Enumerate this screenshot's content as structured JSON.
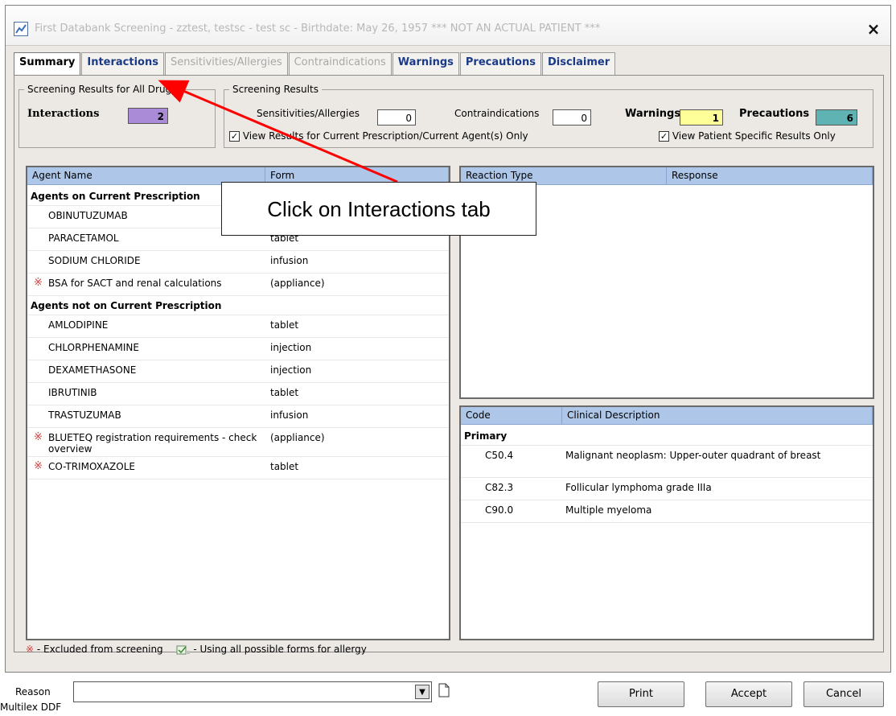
{
  "window": {
    "title": "First Databank Screening  - zztest, testsc  - test sc - Birthdate: May 26, 1957 *** NOT AN ACTUAL PATIENT ***",
    "close_label": "×"
  },
  "tabs": [
    {
      "label": "Summary",
      "state": "active"
    },
    {
      "label": "Interactions",
      "state": "enabled"
    },
    {
      "label": "Sensitivities/Allergies",
      "state": "disabled"
    },
    {
      "label": "Contraindications",
      "state": "disabled"
    },
    {
      "label": "Warnings",
      "state": "enabled"
    },
    {
      "label": "Precautions",
      "state": "enabled"
    },
    {
      "label": "Disclaimer",
      "state": "enabled"
    }
  ],
  "all_drugs": {
    "legend": "Screening Results for All Drugs",
    "interactions_label": "Interactions",
    "interactions_count": "2",
    "interactions_color": "#a98bd8"
  },
  "screening": {
    "legend": "Screening Results",
    "sensitivities_label": "Sensitivities/Allergies",
    "sensitivities_count": "0",
    "contraindications_label": "Contraindications",
    "contraindications_count": "0",
    "warnings_label": "Warnings",
    "warnings_count": "1",
    "warnings_color": "#ffff99",
    "precautions_label": "Precautions",
    "precautions_count": "6",
    "precautions_color": "#5fb3b3",
    "current_only_label": "View Results for Current Prescription/Current Agent(s) Only",
    "current_only_checked": "✓",
    "patient_only_label": "View Patient Specific Results Only",
    "patient_only_checked": "✓"
  },
  "agents": {
    "col_name": "Agent Name",
    "col_form": "Form",
    "group_current": "Agents on Current Prescription",
    "group_not_current": "Agents not on Current Prescription",
    "current": [
      {
        "name": "OBINUTUZUMAB",
        "form": "",
        "excluded": false
      },
      {
        "name": "PARACETAMOL",
        "form": "tablet",
        "excluded": false
      },
      {
        "name": "SODIUM CHLORIDE",
        "form": "infusion",
        "excluded": false
      },
      {
        "name": "BSA for SACT and renal calculations",
        "form": "(appliance)",
        "excluded": true
      }
    ],
    "not_current": [
      {
        "name": "AMLODIPINE",
        "form": "tablet",
        "excluded": false
      },
      {
        "name": "CHLORPHENAMINE",
        "form": "injection",
        "excluded": false
      },
      {
        "name": "DEXAMETHASONE",
        "form": "injection",
        "excluded": false
      },
      {
        "name": "IBRUTINIB",
        "form": "tablet",
        "excluded": false
      },
      {
        "name": "TRASTUZUMAB",
        "form": "infusion",
        "excluded": false
      },
      {
        "name": "BLUETEQ registration requirements - check overview",
        "form": "(appliance)",
        "excluded": true
      },
      {
        "name": "CO-TRIMOXAZOLE",
        "form": "tablet",
        "excluded": true
      }
    ]
  },
  "reactions": {
    "col_type": "Reaction Type",
    "col_response": "Response"
  },
  "codes": {
    "col_code": "Code",
    "col_desc": "Clinical Description",
    "group": "Primary",
    "rows": [
      {
        "code": "C50.4",
        "desc": "Malignant neoplasm: Upper-outer quadrant of breast"
      },
      {
        "code": "C82.3",
        "desc": "Follicular lymphoma grade IIIa"
      },
      {
        "code": "C90.0",
        "desc": "Multiple myeloma"
      }
    ]
  },
  "legend_bar": {
    "excluded_symbol": "※",
    "excluded_text": "- Excluded from screening",
    "allforms_text": "- Using all possible forms for allergy"
  },
  "footer": {
    "reason_label": "Reason",
    "reason_value": "",
    "print_label": "Print",
    "accept_label": "Accept",
    "cancel_label": "Cancel",
    "status": "Multilex DDF"
  },
  "annotation": {
    "text": "Click on Interactions tab",
    "arrow_color": "#ff0000"
  }
}
